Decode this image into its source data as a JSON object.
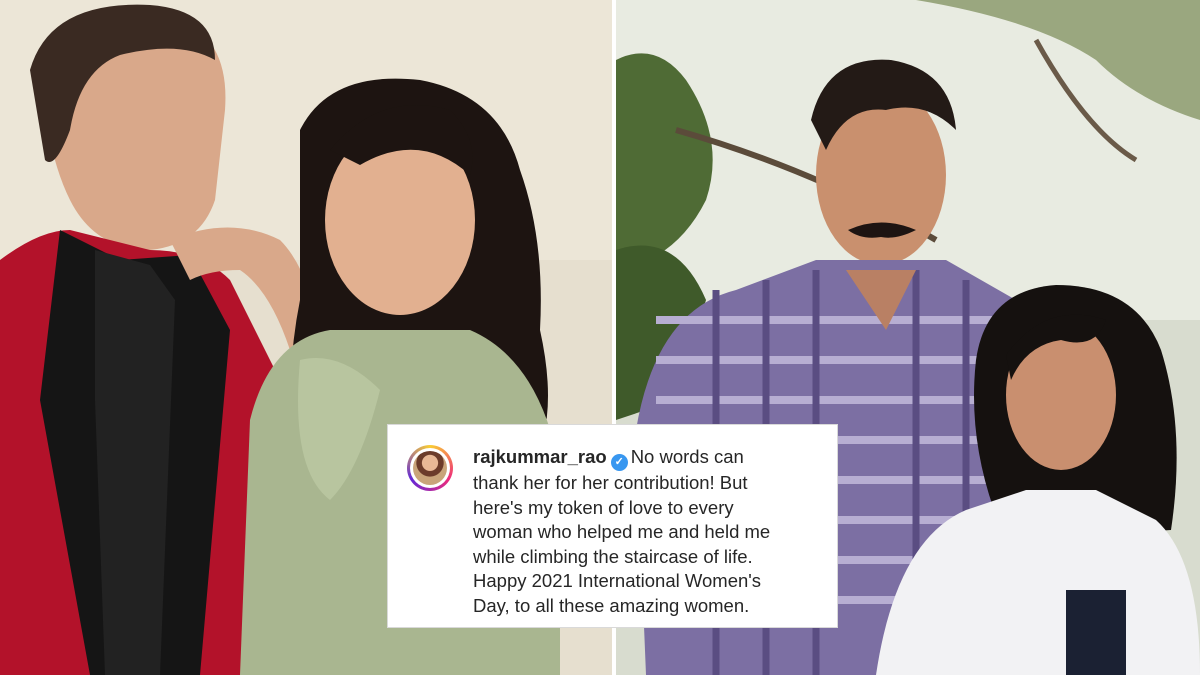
{
  "left_photo": {
    "description_icon": "couple-photo"
  },
  "right_photo": {
    "description_icon": "couple-outdoor-photo"
  },
  "caption": {
    "username": "rajkummar_rao",
    "verified_icon": "verified-badge-icon",
    "text": "No words can\nthank her for her contribution! But\nhere's my token of love to every\nwoman who helped me and held me\nwhile climbing the staircase of life.\nHappy 2021 International Women's\nDay, to all these amazing women."
  },
  "colors": {
    "verified_blue": "#3897f0",
    "card_border": "#d9d9d9",
    "text": "#262626"
  }
}
